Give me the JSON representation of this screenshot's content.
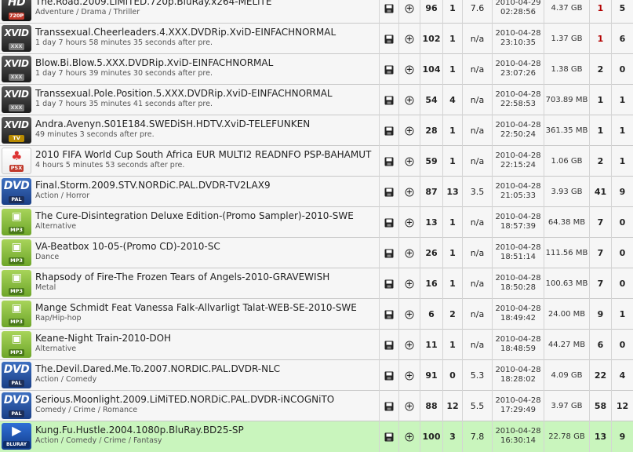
{
  "torrents": [
    {
      "badge": "HD",
      "badge_sub": "720P",
      "badge_style": "hd",
      "title": "The.Road.2009.LiMiTED.720p.BluRay.x264-MELiTE",
      "sub": "Adventure / Drama / Thriller",
      "comments": "96",
      "files": "1",
      "rating": "7.6",
      "date": "2010-04-29",
      "time": "02:28:56",
      "size": "4.37 GB",
      "seeders": "1",
      "leechers": "5",
      "seed_red": true,
      "highlight": false
    },
    {
      "badge": "XVID",
      "badge_sub": "XXX",
      "badge_style": "xvid",
      "title": "Transsexual.Cheerleaders.4.XXX.DVDRip.XviD-EINFACHNORMAL",
      "sub": "1 day 7 hours 58 minutes 35 seconds after pre.",
      "comments": "102",
      "files": "1",
      "rating": "n/a",
      "date": "2010-04-28",
      "time": "23:10:35",
      "size": "1.37 GB",
      "seeders": "1",
      "leechers": "6",
      "seed_red": true,
      "highlight": false
    },
    {
      "badge": "XVID",
      "badge_sub": "XXX",
      "badge_style": "xvid",
      "title": "Blow.Bi.Blow.5.XXX.DVDRip.XviD-EINFACHNORMAL",
      "sub": "1 day 7 hours 39 minutes 30 seconds after pre.",
      "comments": "104",
      "files": "1",
      "rating": "n/a",
      "date": "2010-04-28",
      "time": "23:07:26",
      "size": "1.38 GB",
      "seeders": "2",
      "leechers": "0",
      "seed_red": false,
      "highlight": false
    },
    {
      "badge": "XVID",
      "badge_sub": "XXX",
      "badge_style": "xvid",
      "title": "Transsexual.Pole.Position.5.XXX.DVDRip.XviD-EINFACHNORMAL",
      "sub": "1 day 7 hours 35 minutes 41 seconds after pre.",
      "comments": "54",
      "files": "4",
      "rating": "n/a",
      "date": "2010-04-28",
      "time": "22:58:53",
      "size": "703.89 MB",
      "seeders": "1",
      "leechers": "1",
      "seed_red": false,
      "highlight": false
    },
    {
      "badge": "XVID",
      "badge_sub": "TV",
      "badge_style": "xvid tv",
      "title": "Andra.Avenyn.S01E184.SWEDiSH.HDTV.XviD-TELEFUNKEN",
      "sub": "49 minutes 3 seconds after pre.",
      "comments": "28",
      "files": "1",
      "rating": "n/a",
      "date": "2010-04-28",
      "time": "22:50:24",
      "size": "361.35 MB",
      "seeders": "1",
      "leechers": "1",
      "seed_red": false,
      "highlight": false
    },
    {
      "badge": "♣",
      "badge_sub": "PSX",
      "badge_style": "psx",
      "title": "2010 FIFA World Cup South Africa EUR MULTI2 READNFO PSP-BAHAMUT",
      "sub": "4 hours 5 minutes 53 seconds after pre.",
      "comments": "59",
      "files": "1",
      "rating": "n/a",
      "date": "2010-04-28",
      "time": "22:15:24",
      "size": "1.06 GB",
      "seeders": "2",
      "leechers": "1",
      "seed_red": false,
      "highlight": false
    },
    {
      "badge": "DVD",
      "badge_sub": "PAL",
      "badge_style": "dvd",
      "title": "Final.Storm.2009.STV.NORDiC.PAL.DVDR-TV2LAX9",
      "sub": "Action / Horror",
      "comments": "87",
      "files": "13",
      "rating": "3.5",
      "date": "2010-04-28",
      "time": "21:05:33",
      "size": "3.93 GB",
      "seeders": "41",
      "leechers": "9",
      "seed_red": false,
      "highlight": false
    },
    {
      "badge": "▣",
      "badge_sub": "MP3",
      "badge_style": "mp3",
      "title": "The Cure-Disintegration Deluxe Edition-(Promo Sampler)-2010-SWE",
      "sub": "Alternative",
      "comments": "13",
      "files": "1",
      "rating": "n/a",
      "date": "2010-04-28",
      "time": "18:57:39",
      "size": "64.38 MB",
      "seeders": "7",
      "leechers": "0",
      "seed_red": false,
      "highlight": false
    },
    {
      "badge": "▣",
      "badge_sub": "MP3",
      "badge_style": "mp3",
      "title": "VA-Beatbox 10-05-(Promo CD)-2010-SC",
      "sub": "Dance",
      "comments": "26",
      "files": "1",
      "rating": "n/a",
      "date": "2010-04-28",
      "time": "18:51:14",
      "size": "111.56 MB",
      "seeders": "7",
      "leechers": "0",
      "seed_red": false,
      "highlight": false
    },
    {
      "badge": "▣",
      "badge_sub": "MP3",
      "badge_style": "mp3",
      "title": "Rhapsody of Fire-The Frozen Tears of Angels-2010-GRAVEWISH",
      "sub": "Metal",
      "comments": "16",
      "files": "1",
      "rating": "n/a",
      "date": "2010-04-28",
      "time": "18:50:28",
      "size": "100.63 MB",
      "seeders": "7",
      "leechers": "0",
      "seed_red": false,
      "highlight": false
    },
    {
      "badge": "▣",
      "badge_sub": "MP3",
      "badge_style": "mp3",
      "title": "Mange Schmidt Feat Vanessa Falk-Allvarligt Talat-WEB-SE-2010-SWE",
      "sub": "Rap/Hip-hop",
      "comments": "6",
      "files": "2",
      "rating": "n/a",
      "date": "2010-04-28",
      "time": "18:49:42",
      "size": "24.00 MB",
      "seeders": "9",
      "leechers": "1",
      "seed_red": false,
      "highlight": false
    },
    {
      "badge": "▣",
      "badge_sub": "MP3",
      "badge_style": "mp3",
      "title": "Keane-Night Train-2010-DOH",
      "sub": "Alternative",
      "comments": "11",
      "files": "1",
      "rating": "n/a",
      "date": "2010-04-28",
      "time": "18:48:59",
      "size": "44.27 MB",
      "seeders": "6",
      "leechers": "0",
      "seed_red": false,
      "highlight": false
    },
    {
      "badge": "DVD",
      "badge_sub": "PAL",
      "badge_style": "dvd",
      "title": "The.Devil.Dared.Me.To.2007.NORDIC.PAL.DVDR-NLC",
      "sub": "Action / Comedy",
      "comments": "91",
      "files": "0",
      "rating": "5.3",
      "date": "2010-04-28",
      "time": "18:28:02",
      "size": "4.09 GB",
      "seeders": "22",
      "leechers": "4",
      "seed_red": false,
      "highlight": false
    },
    {
      "badge": "DVD",
      "badge_sub": "PAL",
      "badge_style": "dvd",
      "title": "Serious.Moonlight.2009.LiMiTED.NORDiC.PAL.DVDR-iNCOGNiTO",
      "sub": "Comedy / Crime / Romance",
      "comments": "88",
      "files": "12",
      "rating": "5.5",
      "date": "2010-04-28",
      "time": "17:29:49",
      "size": "3.97 GB",
      "seeders": "58",
      "leechers": "12",
      "seed_red": false,
      "highlight": false
    },
    {
      "badge": "▶",
      "badge_sub": "BLURAY",
      "badge_style": "bluray",
      "title": "Kung.Fu.Hustle.2004.1080p.BluRay.BD25-SP",
      "sub": "Action / Comedy / Crime / Fantasy",
      "comments": "100",
      "files": "3",
      "rating": "7.8",
      "date": "2010-04-28",
      "time": "16:30:14",
      "size": "22.78 GB",
      "seeders": "13",
      "leechers": "9",
      "seed_red": false,
      "highlight": true
    }
  ]
}
